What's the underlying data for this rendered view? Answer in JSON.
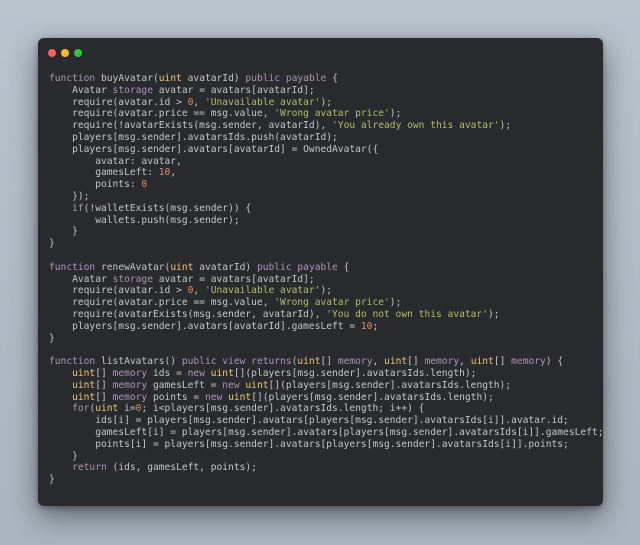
{
  "colors": {
    "background": "#b3bdc6",
    "window": "#282a2e",
    "text": "#c5c8c6",
    "keyword": "#b294bb",
    "type": "#f0c674",
    "string": "#b5bd68",
    "number": "#de935f",
    "close": "#ff5f56",
    "minimize": "#ffbd2e",
    "maximize": "#27c93f"
  },
  "window_controls": [
    "close",
    "minimize",
    "maximize"
  ],
  "code_lines": [
    [
      [
        "kw",
        "function"
      ],
      [
        "pl",
        " buyAvatar("
      ],
      [
        "ty",
        "uint"
      ],
      [
        "pl",
        " avatarId) "
      ],
      [
        "kw",
        "public payable"
      ],
      [
        "pl",
        " {"
      ]
    ],
    [
      [
        "pl",
        "    Avatar "
      ],
      [
        "kw",
        "storage"
      ],
      [
        "pl",
        " avatar = avatars[avatarId];"
      ]
    ],
    [
      [
        "pl",
        "    require(avatar.id > "
      ],
      [
        "nu",
        "0"
      ],
      [
        "pl",
        ", "
      ],
      [
        "st",
        "'Unavailable avatar'"
      ],
      [
        "pl",
        ");"
      ]
    ],
    [
      [
        "pl",
        "    require(avatar.price == msg.value, "
      ],
      [
        "st",
        "'Wrong avatar price'"
      ],
      [
        "pl",
        ");"
      ]
    ],
    [
      [
        "pl",
        "    require(!avatarExists(msg.sender, avatarId), "
      ],
      [
        "st",
        "'You already own this avatar'"
      ],
      [
        "pl",
        ");"
      ]
    ],
    [
      [
        "pl",
        "    players[msg.sender].avatarsIds.push(avatarId);"
      ]
    ],
    [
      [
        "pl",
        "    players[msg.sender].avatars[avatarId] = OwnedAvatar({"
      ]
    ],
    [
      [
        "pl",
        "        avatar: avatar,"
      ]
    ],
    [
      [
        "pl",
        "        gamesLeft: "
      ],
      [
        "nu",
        "10"
      ],
      [
        "pl",
        ","
      ]
    ],
    [
      [
        "pl",
        "        points: "
      ],
      [
        "nu",
        "0"
      ]
    ],
    [
      [
        "pl",
        "    });"
      ]
    ],
    [
      [
        "pl",
        "    "
      ],
      [
        "kw",
        "if"
      ],
      [
        "pl",
        "(!walletExists(msg.sender)) {"
      ]
    ],
    [
      [
        "pl",
        "        wallets.push(msg.sender);"
      ]
    ],
    [
      [
        "pl",
        "    }"
      ]
    ],
    [
      [
        "pl",
        "}"
      ]
    ],
    [
      [
        "pl",
        ""
      ]
    ],
    [
      [
        "kw",
        "function"
      ],
      [
        "pl",
        " renewAvatar("
      ],
      [
        "ty",
        "uint"
      ],
      [
        "pl",
        " avatarId) "
      ],
      [
        "kw",
        "public payable"
      ],
      [
        "pl",
        " {"
      ]
    ],
    [
      [
        "pl",
        "    Avatar "
      ],
      [
        "kw",
        "storage"
      ],
      [
        "pl",
        " avatar = avatars[avatarId];"
      ]
    ],
    [
      [
        "pl",
        "    require(avatar.id > "
      ],
      [
        "nu",
        "0"
      ],
      [
        "pl",
        ", "
      ],
      [
        "st",
        "'Unavailable avatar'"
      ],
      [
        "pl",
        ");"
      ]
    ],
    [
      [
        "pl",
        "    require(avatar.price == msg.value, "
      ],
      [
        "st",
        "'Wrong avatar price'"
      ],
      [
        "pl",
        ");"
      ]
    ],
    [
      [
        "pl",
        "    require(avatarExists(msg.sender, avatarId), "
      ],
      [
        "st",
        "'You do not own this avatar'"
      ],
      [
        "pl",
        ");"
      ]
    ],
    [
      [
        "pl",
        "    players[msg.sender].avatars[avatarId].gamesLeft = "
      ],
      [
        "nu",
        "10"
      ],
      [
        "pl",
        ";"
      ]
    ],
    [
      [
        "pl",
        "}"
      ]
    ],
    [
      [
        "pl",
        ""
      ]
    ],
    [
      [
        "kw",
        "function"
      ],
      [
        "pl",
        " listAvatars() "
      ],
      [
        "kw",
        "public view returns"
      ],
      [
        "pl",
        "("
      ],
      [
        "ty",
        "uint"
      ],
      [
        "pl",
        "[] "
      ],
      [
        "kw",
        "memory"
      ],
      [
        "pl",
        ", "
      ],
      [
        "ty",
        "uint"
      ],
      [
        "pl",
        "[] "
      ],
      [
        "kw",
        "memory"
      ],
      [
        "pl",
        ", "
      ],
      [
        "ty",
        "uint"
      ],
      [
        "pl",
        "[] "
      ],
      [
        "kw",
        "memory"
      ],
      [
        "pl",
        ") {"
      ]
    ],
    [
      [
        "pl",
        "    "
      ],
      [
        "ty",
        "uint"
      ],
      [
        "pl",
        "[] "
      ],
      [
        "kw",
        "memory"
      ],
      [
        "pl",
        " ids = "
      ],
      [
        "kw",
        "new"
      ],
      [
        "pl",
        " "
      ],
      [
        "ty",
        "uint"
      ],
      [
        "pl",
        "[](players[msg.sender].avatarsIds.length);"
      ]
    ],
    [
      [
        "pl",
        "    "
      ],
      [
        "ty",
        "uint"
      ],
      [
        "pl",
        "[] "
      ],
      [
        "kw",
        "memory"
      ],
      [
        "pl",
        " gamesLeft = "
      ],
      [
        "kw",
        "new"
      ],
      [
        "pl",
        " "
      ],
      [
        "ty",
        "uint"
      ],
      [
        "pl",
        "[](players[msg.sender].avatarsIds.length);"
      ]
    ],
    [
      [
        "pl",
        "    "
      ],
      [
        "ty",
        "uint"
      ],
      [
        "pl",
        "[] "
      ],
      [
        "kw",
        "memory"
      ],
      [
        "pl",
        " points = "
      ],
      [
        "kw",
        "new"
      ],
      [
        "pl",
        " "
      ],
      [
        "ty",
        "uint"
      ],
      [
        "pl",
        "[](players[msg.sender].avatarsIds.length);"
      ]
    ],
    [
      [
        "pl",
        "    "
      ],
      [
        "kw",
        "for"
      ],
      [
        "pl",
        "("
      ],
      [
        "ty",
        "uint"
      ],
      [
        "pl",
        " i="
      ],
      [
        "nu",
        "0"
      ],
      [
        "pl",
        "; i<players[msg.sender].avatarsIds.length; i++) {"
      ]
    ],
    [
      [
        "pl",
        "        ids[i] = players[msg.sender].avatars[players[msg.sender].avatarsIds[i]].avatar.id;"
      ]
    ],
    [
      [
        "pl",
        "        gamesLeft[i] = players[msg.sender].avatars[players[msg.sender].avatarsIds[i]].gamesLeft;"
      ]
    ],
    [
      [
        "pl",
        "        points[i] = players[msg.sender].avatars[players[msg.sender].avatarsIds[i]].points;"
      ]
    ],
    [
      [
        "pl",
        "    }"
      ]
    ],
    [
      [
        "pl",
        "    "
      ],
      [
        "kw",
        "return"
      ],
      [
        "pl",
        " (ids, gamesLeft, points);"
      ]
    ],
    [
      [
        "pl",
        "}"
      ]
    ]
  ]
}
